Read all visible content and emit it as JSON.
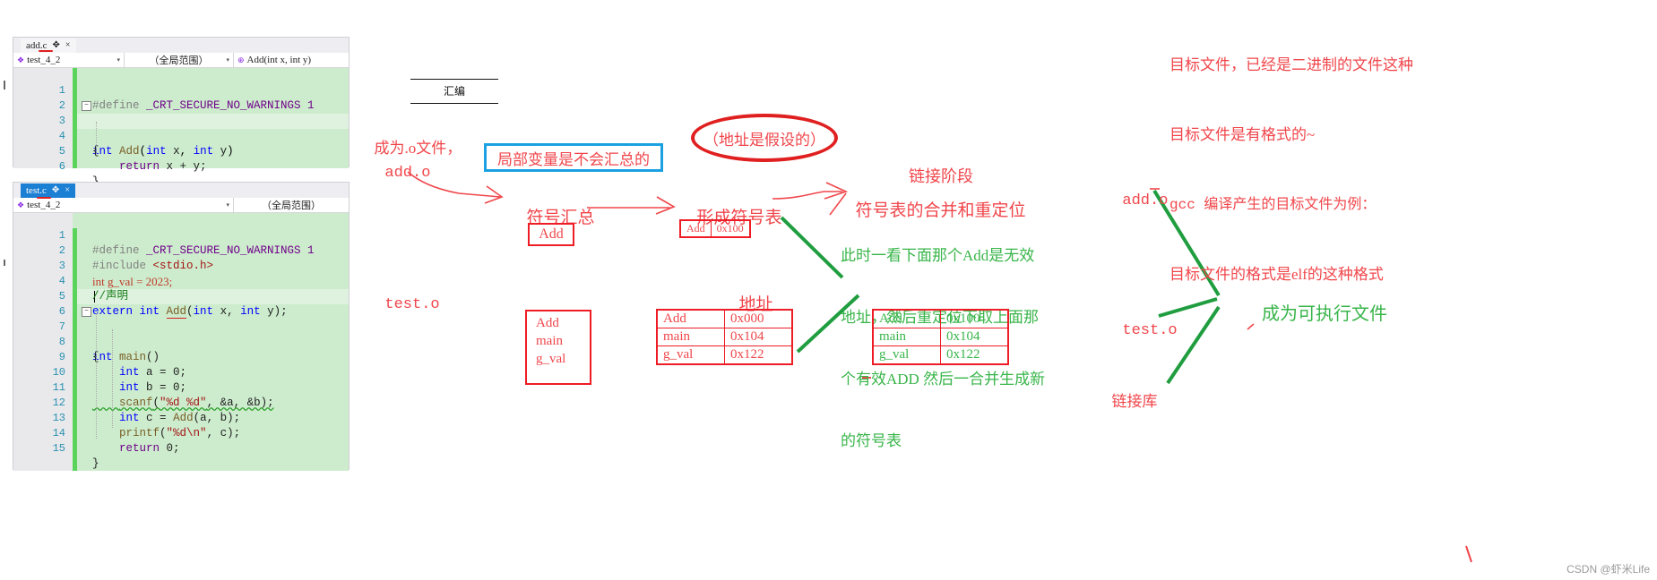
{
  "editors": [
    {
      "name": "add-c-editor",
      "tab": {
        "label": "add.c",
        "pin": "✥",
        "close": "×",
        "active": false
      },
      "navbar": [
        {
          "name": "project-combo",
          "icon": "❖",
          "label": "test_4_2",
          "arrow": "▾"
        },
        {
          "name": "scope-combo",
          "label": "（全局范围）",
          "arrow": "▾"
        },
        {
          "name": "member-combo",
          "icon": "⊕",
          "label": "Add(int x, int y)",
          "arrow": ""
        }
      ],
      "lines": [
        {
          "n": "1",
          "text": "#define _CRT_SECURE_NO_WARNINGS 1"
        },
        {
          "n": "2",
          "text": ""
        },
        {
          "n": "3",
          "text": "int Add(int x, int y)"
        },
        {
          "n": "4",
          "text": "{"
        },
        {
          "n": "5",
          "text": "    return x + y;"
        },
        {
          "n": "6",
          "text": "}"
        }
      ]
    },
    {
      "name": "test-c-editor",
      "tab": {
        "label": "test.c",
        "pin": "✥",
        "close": "×",
        "active": true
      },
      "navbar": [
        {
          "name": "project-combo",
          "icon": "❖",
          "label": "test_4_2",
          "arrow": "▾"
        },
        {
          "name": "scope-combo",
          "label": "（全局范围）",
          "arrow": ""
        }
      ],
      "lines": [
        {
          "n": "1",
          "text": "#define _CRT_SECURE_NO_WARNINGS 1"
        },
        {
          "n": "2",
          "text": "#include <stdio.h>"
        },
        {
          "n": "3",
          "text": "int g_val = 2023;"
        },
        {
          "n": "4",
          "text": "//声明"
        },
        {
          "n": "5",
          "text": "extern int Add(int x, int y);"
        },
        {
          "n": "6",
          "text": ""
        },
        {
          "n": "7",
          "text": "int main()"
        },
        {
          "n": "8",
          "text": "{"
        },
        {
          "n": "9",
          "text": "    int a = 0;"
        },
        {
          "n": "10",
          "text": "    int b = 0;"
        },
        {
          "n": "11",
          "text": "    scanf(\"%d %d\", &a, &b);"
        },
        {
          "n": "12",
          "text": "    int c = Add(a, b);"
        },
        {
          "n": "13",
          "text": "    printf(\"%d\\n\", c);"
        },
        {
          "n": "14",
          "text": "    return 0;"
        },
        {
          "n": "15",
          "text": "}"
        }
      ]
    }
  ],
  "diagram": {
    "assemble_label": "汇编",
    "become_o_line1": "成为.o文件，",
    "add_o": "add.o",
    "test_o": "test.o",
    "blue_note": "局部变量是不会汇总的",
    "ellipse_note": "（地址是假设的）",
    "symbol_summary": "符号汇总",
    "form_symbol_table": "形成符号表",
    "link_stage": "链接阶段",
    "merge_relocate": "符号表的合并和重定位",
    "address_label": "地址",
    "green_note_lines": [
      "此时一看下面那个Add是无效",
      "地址，然后重定位下取上面那",
      "个有效ADD 然后一合并生成新",
      "的符号表"
    ],
    "add_chip": "Add",
    "add_addr_chip": {
      "sym": "Add",
      "addr": "0x100"
    },
    "plain_list": [
      "Add",
      "main",
      "g_val"
    ],
    "table_red": {
      "rows": [
        {
          "sym": "Add",
          "addr": "0x000"
        },
        {
          "sym": "main",
          "addr": "0x104"
        },
        {
          "sym": "g_val",
          "addr": "0x122"
        }
      ]
    },
    "table_green": {
      "rows": [
        {
          "sym": "Add",
          "addr": "0x100"
        },
        {
          "sym": "main",
          "addr": "0x104"
        },
        {
          "sym": "g_val",
          "addr": "0x122"
        }
      ]
    },
    "right": {
      "add_o": "add.o",
      "test_o": "test.o",
      "link_lib": "链接库",
      "executable": "成为可执行文件"
    }
  },
  "top_note": {
    "lines": [
      "目标文件，已经是二进制的文件这种",
      "目标文件是有格式的~",
      "gcc 编译产生的目标文件为例：",
      "目标文件的格式是elf的这种格式"
    ]
  },
  "watermark": "CSDN @虾米Life",
  "colors": {
    "red_ink": "#f0464b",
    "red_box": "#ee1c25",
    "green_ink": "#39b54a",
    "blue_box": "#1ba1e2",
    "code_bg": "#cdeccd",
    "change_bar": "#5ad45a"
  }
}
